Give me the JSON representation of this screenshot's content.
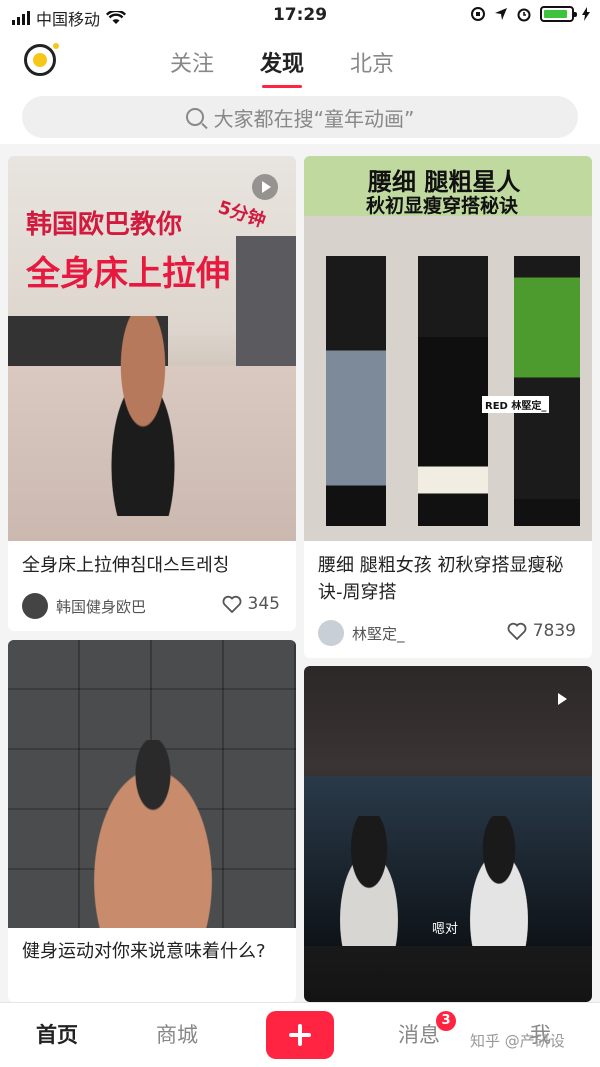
{
  "status_bar": {
    "carrier": "中国移动",
    "time": "17:29",
    "battery_level": 0.9
  },
  "header": {
    "tabs": [
      {
        "label": "关注",
        "active": false
      },
      {
        "label": "发现",
        "active": true
      },
      {
        "label": "北京",
        "active": false
      }
    ],
    "search": {
      "placeholder": "大家都在搜“童年动画”"
    }
  },
  "feed": {
    "cards": [
      {
        "title": "全身床上拉伸침대스트레칭",
        "author": "韩国健身欧巴",
        "likes": "345",
        "overlay_line1": "韩国欧巴教你",
        "overlay_line2": "全身床上拉伸",
        "overlay_tag": "5分钟",
        "is_video": true
      },
      {
        "title": "腰细 腿粗女孩 初秋穿搭显瘦秘诀-周穿搭",
        "author": "林堅定_",
        "likes": "7839",
        "overlay_line1": "腰细  腿粗星人",
        "overlay_line2": "秋初显瘦穿搭秘诀",
        "overlay_tag": "RED 林堅定_",
        "is_video": false
      },
      {
        "title": "健身运动对你来说意味着什么?",
        "author": "",
        "likes": "",
        "is_video": false
      },
      {
        "title": "",
        "author": "",
        "likes": "",
        "subtitle": "嗯对",
        "is_video": true
      }
    ]
  },
  "bottom_nav": {
    "items": [
      {
        "label": "首页",
        "active": true
      },
      {
        "label": "商城",
        "active": false
      },
      {
        "label": "消息",
        "active": false,
        "badge": "3"
      },
      {
        "label": "我",
        "active": false
      }
    ],
    "watermark": "知乎 @产研设"
  },
  "colors": {
    "accent": "#ff2442",
    "logo_yellow": "#f6c619"
  }
}
